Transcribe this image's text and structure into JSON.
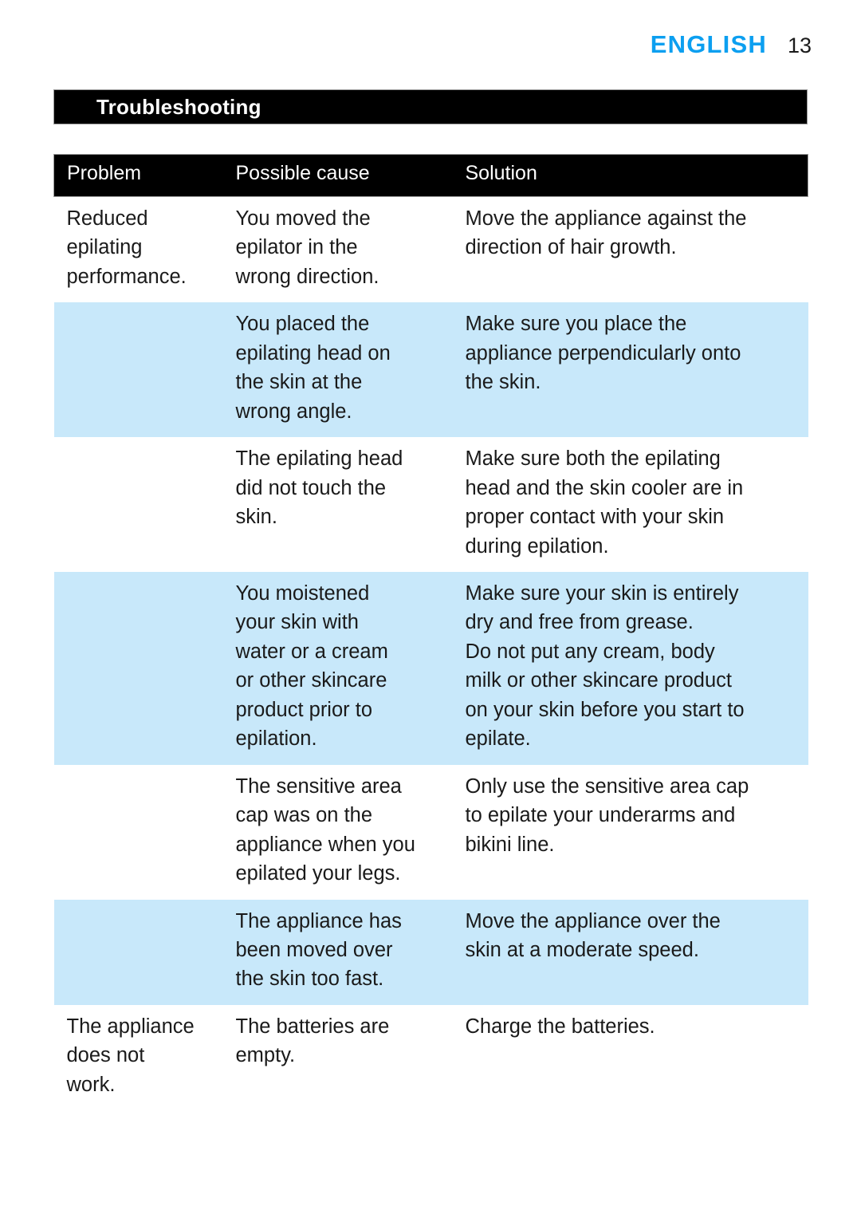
{
  "header": {
    "language": "ENGLISH",
    "page_number": "13"
  },
  "section": {
    "title": "Troubleshooting"
  },
  "table": {
    "columns": [
      "Problem",
      "Possible cause",
      "Solution"
    ],
    "rows": [
      {
        "shaded": false,
        "problem": "Reduced\nepilating\nperformance.",
        "cause": "You moved the\nepilator in the\nwrong direction.",
        "solution": "Move the appliance against the\ndirection of hair growth."
      },
      {
        "shaded": true,
        "problem": "",
        "cause": "You placed the\nepilating head on\nthe skin at the\nwrong angle.",
        "solution": "Make sure you place the\nappliance perpendicularly onto\nthe skin."
      },
      {
        "shaded": false,
        "problem": "",
        "cause": "The epilating head\ndid not touch the\nskin.",
        "solution": "Make sure both the epilating\nhead and the skin cooler are in\nproper contact with your skin\nduring epilation."
      },
      {
        "shaded": true,
        "problem": "",
        "cause": "You moistened\nyour skin with\nwater or a cream\nor other skincare\nproduct prior to\nepilation.",
        "solution": "Make sure your skin is entirely\ndry and free from grease.\nDo not put any cream, body\nmilk or other skincare product\non your skin before you start to\nepilate."
      },
      {
        "shaded": false,
        "problem": "",
        "cause": "The sensitive area\ncap was on the\nappliance when you\nepilated your legs.",
        "solution": "Only use the sensitive area cap\nto epilate your underarms and\nbikini line."
      },
      {
        "shaded": true,
        "problem": "",
        "cause": "The appliance has\nbeen moved over\nthe skin too fast.",
        "solution": "Move the appliance over the\nskin at a moderate speed."
      },
      {
        "shaded": false,
        "problem": "The appliance\ndoes not\nwork.",
        "cause": "The batteries are\nempty.",
        "solution": "Charge the batteries."
      }
    ]
  },
  "colors": {
    "accent_blue": "#0c9ff0",
    "row_shade": "#c8e8fa",
    "bar_background": "#000000"
  }
}
